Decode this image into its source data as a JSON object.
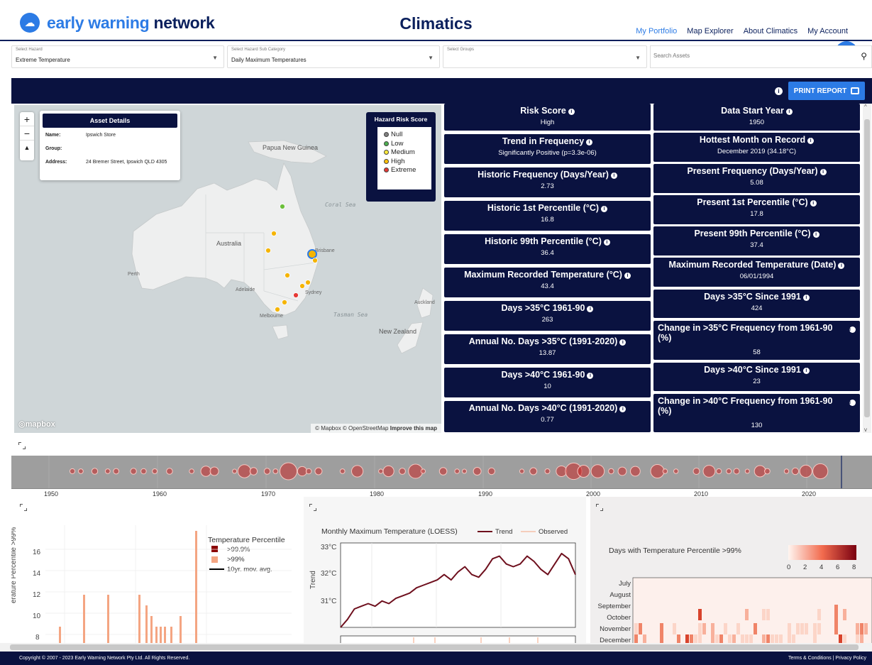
{
  "header": {
    "logo_prefix": "early warning ",
    "logo_suffix": "network",
    "title": "Climatics",
    "nav": [
      "My Portfolio",
      "Map Explorer",
      "About Climatics",
      "My Account"
    ]
  },
  "filters": {
    "hazard_label": "Select Hazard",
    "hazard_value": "Extreme Temperature",
    "subcat_label": "Select Hazard Sub Category",
    "subcat_value": "Daily Maximum Temperatures",
    "groups_label": "Select Groups",
    "groups_value": "",
    "search_placeholder": "Search Assets"
  },
  "report": {
    "print_label": "PRINT REPORT"
  },
  "map": {
    "asset_details_title": "Asset Details",
    "name_key": "Name:",
    "name_value": "Ipswich Store",
    "group_key": "Group:",
    "group_value": "",
    "address_key": "Address:",
    "address_value": "24 Bremer Street, Ipswich QLD 4305",
    "legend_title": "Hazard Risk Score",
    "legend_items": [
      {
        "label": "Null",
        "color": "#808080"
      },
      {
        "label": "Low",
        "color": "#4caf50"
      },
      {
        "label": "Medium",
        "color": "#ffeb3b"
      },
      {
        "label": "High",
        "color": "#ffc107"
      },
      {
        "label": "Extreme",
        "color": "#e53935"
      }
    ],
    "labels": {
      "papua": "Papua New Guinea",
      "coral": "Coral Sea",
      "australia": "Australia",
      "brisbane": "Brisbane",
      "perth": "Perth",
      "adelaide": "Adelaide",
      "sydney": "Sydney",
      "melbourne": "Melbourne",
      "tasman": "Tasman Sea",
      "auckland": "Auckland",
      "nz": "New Zealand"
    },
    "mapbox_logo": "mapbox",
    "attribution": "© Mapbox © OpenStreetMap",
    "improve": "Improve this map"
  },
  "metrics_left": [
    {
      "title": "Risk Score",
      "value": "High"
    },
    {
      "title": "Trend in Frequency",
      "value": "Significantly Positive (p=3.3e-06)"
    },
    {
      "title": "Historic Frequency (Days/Year)",
      "value": "2.73"
    },
    {
      "title": "Historic 1st Percentile (°C)",
      "value": "16.8"
    },
    {
      "title": "Historic 99th Percentile (°C)",
      "value": "36.4"
    },
    {
      "title": "Maximum Recorded Temperature (°C)",
      "value": "43.4"
    },
    {
      "title": "Days >35°C 1961-90",
      "value": "263"
    },
    {
      "title": "Annual No. Days >35°C (1991-2020)",
      "value": "13.87"
    },
    {
      "title": "Days >40°C 1961-90",
      "value": "10"
    },
    {
      "title": "Annual No. Days >40°C (1991-2020)",
      "value": "0.77"
    }
  ],
  "metrics_right": [
    {
      "title": "Data Start Year",
      "value": "1950"
    },
    {
      "title": "Hottest Month on Record",
      "value": "December 2019 (34.18°C)"
    },
    {
      "title": "Present Frequency (Days/Year)",
      "value": "5.08"
    },
    {
      "title": "Present 1st Percentile (°C)",
      "value": "17.8"
    },
    {
      "title": "Present 99th Percentile (°C)",
      "value": "37.4"
    },
    {
      "title": "Maximum Recorded Temperature (Date)",
      "value": "06/01/1994"
    },
    {
      "title": "Days >35°C Since 1991",
      "value": "424"
    },
    {
      "title": "Change in >35°C Frequency from 1961-90 (%)",
      "value": "58"
    },
    {
      "title": "Days >40°C Since 1991",
      "value": "23"
    },
    {
      "title": "Change in >40°C Frequency from 1961-90 (%)",
      "value": "130"
    }
  ],
  "timeline": {
    "years": [
      "1950",
      "1960",
      "1970",
      "1980",
      "1990",
      "2000",
      "2010",
      "2020"
    ]
  },
  "chart_data": [
    {
      "type": "bar",
      "ylabel": "erature Percentile >99%",
      "yticks": [
        "16",
        "14",
        "12",
        "10",
        "8"
      ],
      "legend_title": "Temperature Percentile",
      "legend": [
        ">99.9%",
        ">99%",
        "10yr. mov. avg."
      ],
      "colors": {
        ">99.9%": "#8b0000",
        ">99%": "#f4a582",
        "10yr. mov. avg.": "#000000"
      },
      "values": [
        8,
        11,
        11,
        11,
        10,
        9,
        8,
        8,
        8,
        8,
        9,
        17
      ]
    },
    {
      "type": "line",
      "title": "Monthly Maximum Temperature (LOESS)",
      "legend": [
        "Trend",
        "Observed"
      ],
      "ylabel": "Trend",
      "yticks": [
        "33°C",
        "32°C",
        "31°C"
      ],
      "ylim": [
        30.2,
        33.4
      ],
      "values": [
        30.2,
        30.5,
        30.9,
        31.0,
        31.1,
        31.0,
        31.2,
        31.1,
        31.3,
        31.4,
        31.5,
        31.7,
        31.8,
        31.9,
        32.0,
        32.2,
        32.0,
        32.3,
        32.5,
        32.2,
        32.1,
        32.4,
        32.8,
        32.9,
        32.6,
        32.5,
        32.6,
        32.9,
        32.7,
        32.4,
        32.2,
        32.6,
        33.0,
        32.8,
        32.2
      ]
    },
    {
      "type": "heatmap",
      "title": "Days with Temperature Percentile >99%",
      "colorbar_ticks": [
        "0",
        "2",
        "4",
        "6",
        "8"
      ],
      "y_categories": [
        "July",
        "August",
        "September",
        "October",
        "November",
        "December"
      ]
    }
  ],
  "footer": {
    "copyright": "Copyright © 2007 - 2023 Early Warning Network Pty Ltd. All Rights Reserved.",
    "links": "Terms & Conditions | Privacy Policy"
  }
}
